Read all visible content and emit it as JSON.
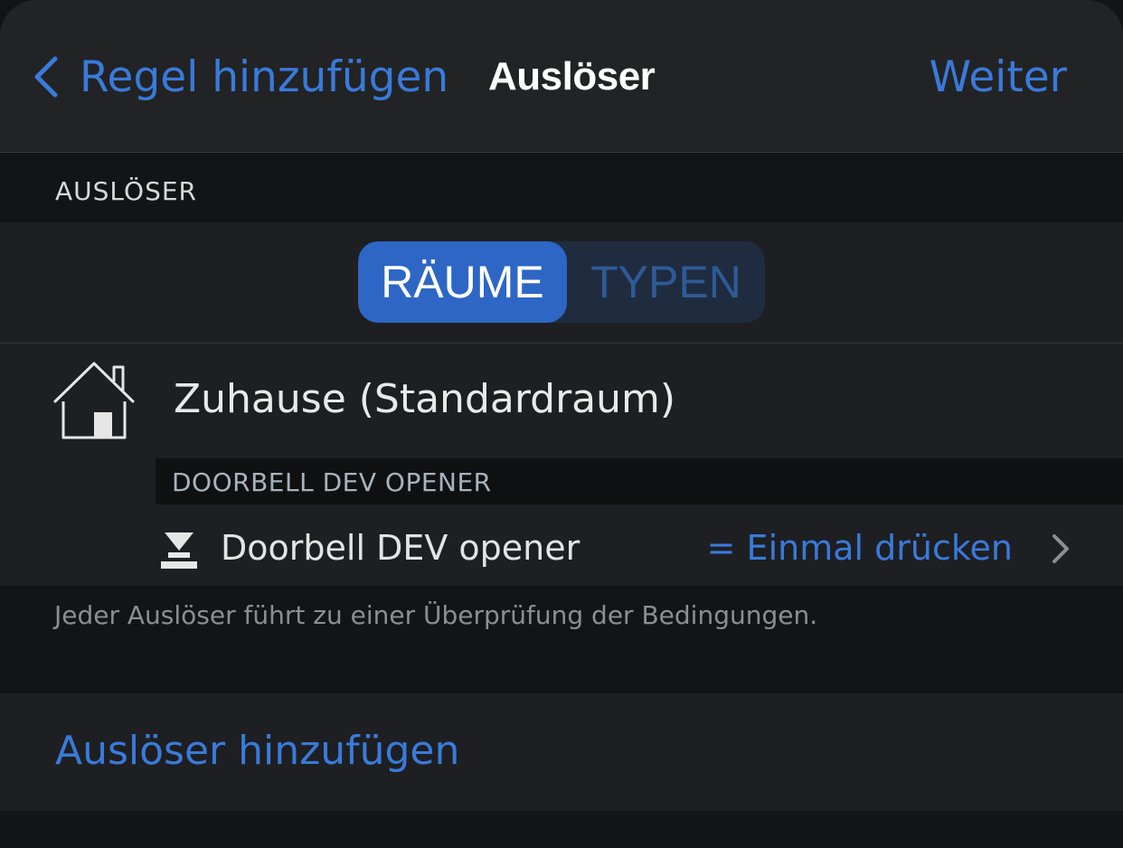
{
  "navbar": {
    "back_label": "Regel hinzufügen",
    "title": "Auslöser",
    "next_label": "Weiter"
  },
  "section": {
    "header": "AUSLÖSER"
  },
  "segmented_control": {
    "options": [
      "RÄUME",
      "TYPEN"
    ],
    "selected": "RÄUME"
  },
  "room": {
    "icon": "house-icon",
    "name": "Zuhause (Standardraum)",
    "device_group": "DOORBELL DEV OPENER",
    "device": {
      "icon": "doorbell-opener-icon",
      "name": "Doorbell DEV opener",
      "value": "= Einmal drücken"
    }
  },
  "footnote": "Jeder Auslöser führt zu einer Überprüfung der Bedingungen.",
  "add_trigger_label": "Auslöser hinzufügen",
  "colors": {
    "accent": "#3a7ad9",
    "segment_active": "#2d66c5",
    "background": "#131417",
    "cell": "#1d1f22"
  }
}
